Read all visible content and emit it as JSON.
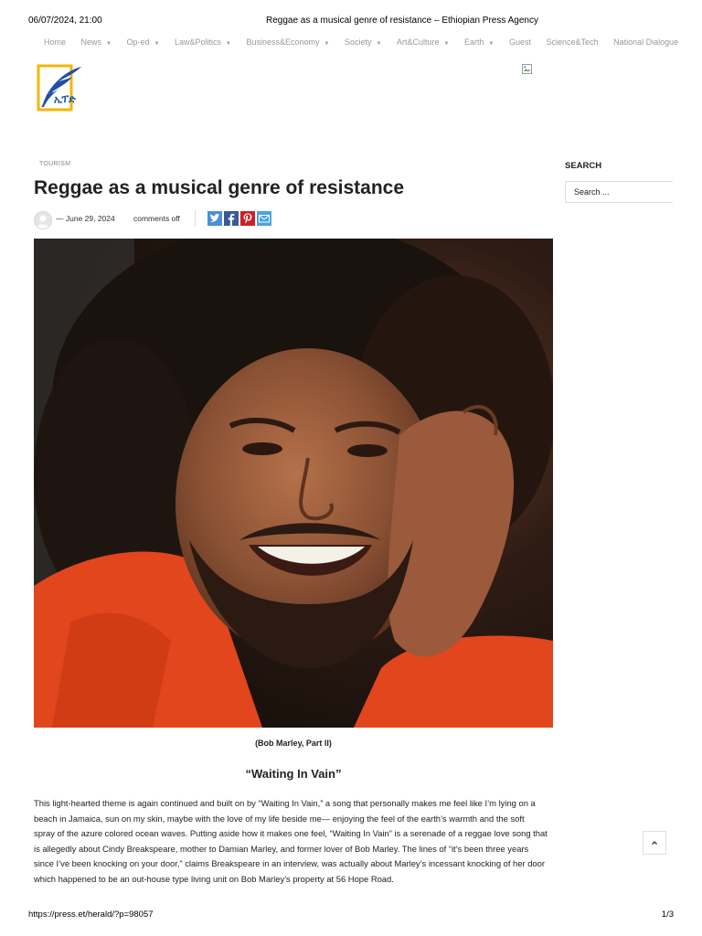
{
  "print_header": {
    "datetime": "06/07/2024, 21:00",
    "page_title": "Reggae as a musical genre of resistance – Ethiopian Press Agency"
  },
  "nav": {
    "items": [
      {
        "label": "Home",
        "has_dropdown": false
      },
      {
        "label": "News",
        "has_dropdown": true
      },
      {
        "label": "Op-ed",
        "has_dropdown": true
      },
      {
        "label": "Law&Politics",
        "has_dropdown": true
      },
      {
        "label": "Business&Economy",
        "has_dropdown": true
      },
      {
        "label": "Society",
        "has_dropdown": true
      },
      {
        "label": "Art&Culture",
        "has_dropdown": true
      },
      {
        "label": "Earth",
        "has_dropdown": true
      },
      {
        "label": "Guest",
        "has_dropdown": false
      },
      {
        "label": "Science&Tech",
        "has_dropdown": false
      },
      {
        "label": "National Dialogue",
        "has_dropdown": false
      }
    ]
  },
  "logo": {
    "text": "ኢፕድ",
    "accent_color": "#f2b705",
    "brand_color": "#1f4fa8"
  },
  "article": {
    "category": "TOURISM",
    "title": "Reggae as a musical genre of resistance",
    "date": "— June 29, 2024",
    "comments": "comments off",
    "share": [
      {
        "name": "twitter-icon",
        "color": "#4a90d9"
      },
      {
        "name": "facebook-icon",
        "color": "#3b5998"
      },
      {
        "name": "pinterest-icon",
        "color": "#cb2027"
      },
      {
        "name": "email-icon",
        "color": "#4aa3df"
      }
    ],
    "image_caption": "(Bob Marley, Part II)",
    "subheading": "“Waiting In Vain”",
    "body": "This light-hearted theme is again continued and built on by “Waiting In Vain,” a song that personally makes me feel like I’m lying on a beach in Jamaica, sun on my skin, maybe with the love of my life beside me— enjoying the feel of the earth’s warmth and the soft spray of the azure colored ocean waves. Putting aside how it makes one feel, “Waiting In Vain” is a serenade of a reggae love song that is allegedly about Cindy Breakspeare, mother to Damian Marley, and former lover of Bob Marley. The lines of “it’s been three years since I’ve been knocking on your door,” claims Breakspeare in an interview, was actually about Marley’s incessant knocking of her door which happened to be an out-house type living unit on Bob Marley’s property at 56 Hope Road."
  },
  "sidebar": {
    "search_title": "SEARCH",
    "search_placeholder": "Search ..."
  },
  "footer": {
    "url": "https://press.et/herald/?p=98057",
    "page": "1/3"
  }
}
